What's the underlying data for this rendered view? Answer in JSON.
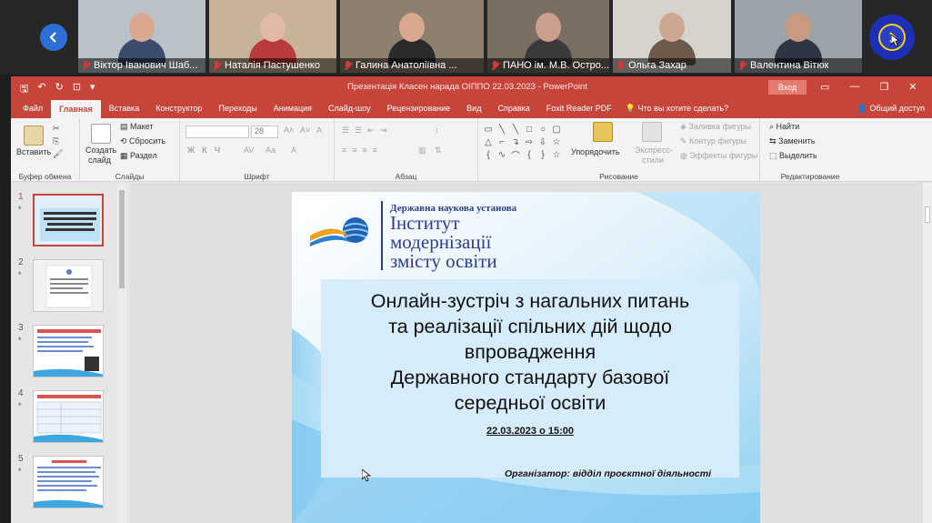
{
  "participants": [
    {
      "name": "Віктор Іванович Шаб...",
      "bg": "#b9c2c9",
      "skin": "#d9a88f",
      "shirt": "#3c4a6b"
    },
    {
      "name": "Наталія Пастушенко",
      "bg": "#c7b39a",
      "skin": "#e2b9a2",
      "shirt": "#b93b3b"
    },
    {
      "name": "Галина Анатоліївна ...",
      "bg": "#8e8070",
      "skin": "#d8a98c",
      "shirt": "#2b2b2b"
    },
    {
      "name": "ПАНО ім. М.В. Остро...",
      "bg": "#7b6e62",
      "skin": "#caa08a",
      "shirt": "#3a3a3a"
    },
    {
      "name": "Ольга Захар",
      "bg": "#d6d3cc",
      "skin": "#cfa68f",
      "shirt": "#6c5b4d"
    },
    {
      "name": "Валентина Вітюк",
      "bg": "#9aa3a8",
      "skin": "#c99a80",
      "shirt": "#2e3442"
    }
  ],
  "window": {
    "doc_title": "Презентація Класен нарада ОІППО 22.03.2023  -  PowerPoint",
    "signin_label": "Вход"
  },
  "tabs": [
    "Файл",
    "Главная",
    "Вставка",
    "Конструктор",
    "Переходы",
    "Анимация",
    "Слайд-шоу",
    "Рецензирование",
    "Вид",
    "Справка",
    "Foxit Reader PDF"
  ],
  "tell_me": "Что вы хотите сделать?",
  "share_label": "Общий доступ",
  "ribbon": {
    "clipboard": {
      "paste": "Вставить",
      "label": "Буфер обмена"
    },
    "slides": {
      "new_slide": "Создать",
      "new_slide_2": "слайд",
      "layout": "Макет",
      "reset": "Сбросить",
      "section": "Раздел",
      "label": "Слайды"
    },
    "font": {
      "size": "28",
      "label": "Шрифт"
    },
    "paragraph": {
      "label": "Абзац"
    },
    "drawing": {
      "arrange": "Упорядочить",
      "quick_styles": "Экспресс-",
      "quick_styles_2": "стили",
      "fill": "Заливка фигуры",
      "outline": "Контур фигуры",
      "effects": "Эффекты фигуры",
      "label": "Рисование"
    },
    "editing": {
      "find": "Найти",
      "replace": "Заменить",
      "select": "Выделить",
      "label": "Редактирование"
    }
  },
  "thumbnails": [
    {
      "num": "1",
      "star": "*"
    },
    {
      "num": "2",
      "star": "*"
    },
    {
      "num": "3",
      "star": "*"
    },
    {
      "num": "4",
      "star": "*"
    },
    {
      "num": "5",
      "star": "*"
    }
  ],
  "slide": {
    "inst_subtitle": "Державна наукова установа",
    "inst_title_1": "Інститут",
    "inst_title_2": "модернізації",
    "inst_title_3": "змісту освіти",
    "headline": [
      "Онлайн-зустріч з нагальних питань",
      "та реалізації спільних дій щодо",
      "впровадження",
      "Державного стандарту базової",
      "середньої освіти"
    ],
    "date": "22.03.2023 о 15:00",
    "organizer": "Організатор: відділ проєктної діяльності"
  },
  "colors": {
    "accent": "#c6443a",
    "slide_blue": "#2d3d8e"
  }
}
